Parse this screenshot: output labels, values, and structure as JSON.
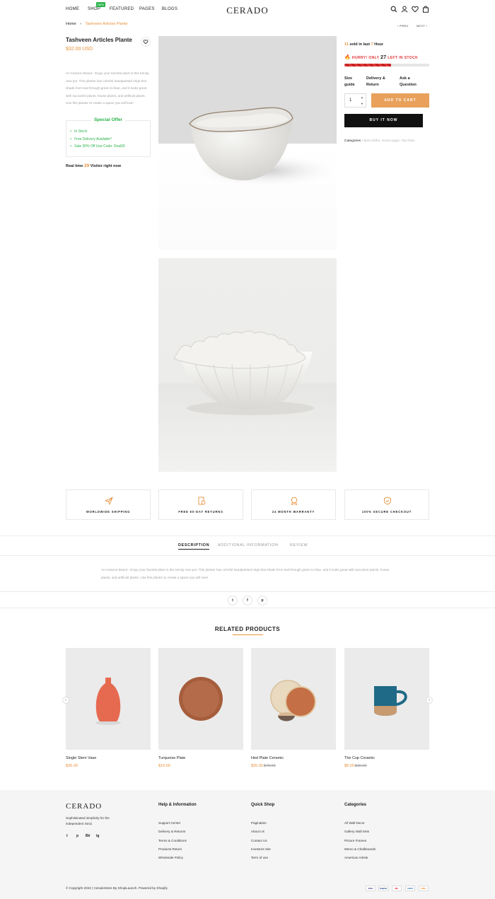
{
  "header": {
    "nav": [
      "HOME",
      "SHOP",
      "FEATURED",
      "PAGES",
      "BLOGS"
    ],
    "badge": "NEW",
    "logo": "CERADO"
  },
  "breadcrumb": {
    "home": "Home",
    "current": "Tashveen Articles Plante"
  },
  "pager": {
    "prev": "PREV",
    "next": "NEXT"
  },
  "product": {
    "title": "Tashveen Articles Plante",
    "price": "$32.00 USD",
    "description": "An Amazon Brand - Enjoy your favorite plant in this trendy new pot. This planter has colorful handpainted rings that shade from teal through green to blue, and it looks great with succulent plants, house plants, and artificial plants. Use this planter to create a space you will love!",
    "offer_title": "Special Offer",
    "offers": [
      "In Stock",
      "Free Delivery Available*",
      "Sale 30% Off Use Code: Deal30"
    ],
    "realtime_pre": "Real time",
    "realtime_count": "29",
    "realtime_post": "Visitor right now"
  },
  "buybox": {
    "sold_count": "11",
    "sold_mid": "sold in last",
    "sold_hours": "7",
    "sold_unit": "Hour",
    "hurry_pre": "HURRY! ONLY",
    "hurry_count": "27",
    "hurry_post": "LEFT IN STOCK",
    "stock_level": 0.55,
    "links": [
      "Size guide",
      "Delivery & Return",
      "Ask a Question"
    ],
    "quantity": "1",
    "add_to_cart": "ADD TO CART",
    "buy_now": "BUY IT NOW",
    "categories_label": "Categories :",
    "categories": "Best Seller, Home page, Top Rate"
  },
  "features": [
    "WORLDWIDE SHIPPING",
    "FREE 60-DAY RETURNS",
    "24 MONTH WARRANTY",
    "100% SECURE CHECKOUT"
  ],
  "tabs": {
    "items": [
      "DESCRIPTION",
      "ADDITIONAL INFORMATION",
      "REVIEW"
    ],
    "description": "An Amazon Brand - Enjoy your favorite plant in this trendy new pot. This planter has colorful handpainted rings that shade from teal through green to blue, and it looks great with succulent plants, house plants, and artificial plants. Use this planter to create a space you will love!"
  },
  "share": [
    "t",
    "f",
    "p"
  ],
  "related": {
    "title": "RELATED PRODUCTS",
    "products": [
      {
        "name": "Single Stem Vase",
        "price": "$36.00",
        "old": ""
      },
      {
        "name": "Turquoise Plate",
        "price": "$10.00",
        "old": ""
      },
      {
        "name": "Hed Plate Ceramic",
        "price": "$35.00",
        "old": "$70.00"
      },
      {
        "name": "The Cup Ceramic",
        "price": "$8.00",
        "old": "$30.00"
      }
    ]
  },
  "footer": {
    "logo": "CERADO",
    "tagline": "Sophisticated simplicity for the independent mind.",
    "social": [
      "t",
      "p",
      "Bē",
      "ig"
    ],
    "columns": [
      {
        "title": "Help & Information",
        "links": [
          "Support Center",
          "Delivery & Returns",
          "Terms & Conditions",
          "Products Return",
          "Wholesale Policy"
        ]
      },
      {
        "title": "Quick Shop",
        "links": [
          "Pagination",
          "About Us",
          "Contact Us",
          "Investors Site",
          "Term of use"
        ]
      },
      {
        "title": "Categories",
        "links": [
          "All Wall Decor",
          "Gallery Wall Sets",
          "Picture Frames",
          "Memo & Chalkboards",
          "American Artists"
        ]
      }
    ],
    "copyright": "© Copyright 2022 | CeradoStore By ShopiLaunch. Powered by Shopify.",
    "payments": [
      "VISA",
      "PayPal",
      "MC",
      "AMEX",
      "DISC"
    ]
  },
  "colors": {
    "accent": "#e8913b",
    "green": "#2bb34a",
    "red": "#e03a3a",
    "dark": "#111111"
  }
}
